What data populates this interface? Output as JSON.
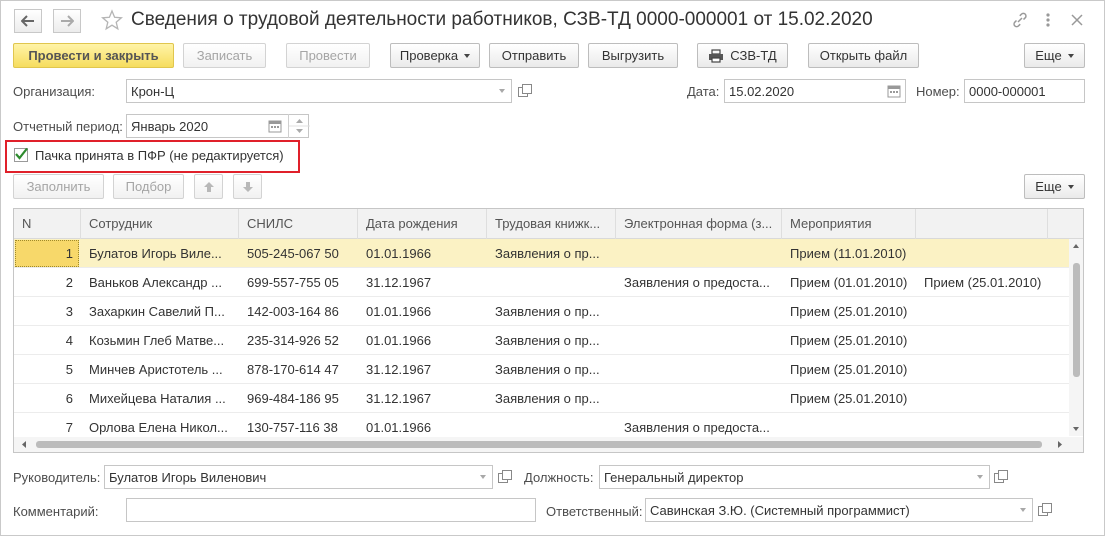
{
  "window": {
    "title": "Сведения о трудовой деятельности работников, СЗВ-ТД 0000-000001 от 15.02.2020",
    "icons": [
      "back-arrow-icon",
      "forward-arrow-icon",
      "star-icon",
      "link-icon",
      "more-vertical-icon",
      "close-icon"
    ]
  },
  "toolbar": {
    "post_close": "Провести и закрыть",
    "save": "Записать",
    "post": "Провести",
    "check": "Проверка",
    "send": "Отправить",
    "upload": "Выгрузить",
    "print_szv": "СЗВ-ТД",
    "open_file": "Открыть файл",
    "more": "Еще"
  },
  "form": {
    "org_label": "Организация:",
    "org_value": "Крон-Ц",
    "date_label": "Дата:",
    "date_value": "15.02.2020",
    "number_label": "Номер:",
    "number_value": "0000-000001",
    "period_label": "Отчетный период:",
    "period_value": "Январь 2020",
    "accepted_checked": true,
    "accepted_label": "Пачка принята в ПФР (не редактируется)"
  },
  "table_toolbar": {
    "fill": "Заполнить",
    "select": "Подбор",
    "more": "Еще"
  },
  "table": {
    "headers": [
      "N",
      "Сотрудник",
      "СНИЛС",
      "Дата рождения",
      "Трудовая книжк...",
      "Электронная форма (з...",
      "Мероприятия",
      ""
    ],
    "rows": [
      [
        "1",
        "Булатов Игорь Виле...",
        "505-245-067 50",
        "01.01.1966",
        "Заявления о пр...",
        "",
        "Прием (11.01.2010)",
        ""
      ],
      [
        "2",
        "Ваньков Александр ...",
        "699-557-755 05",
        "31.12.1967",
        "",
        "Заявления о предоста...",
        "Прием (01.01.2010)",
        "Прием (25.01.2010)"
      ],
      [
        "3",
        "Захаркин Савелий П...",
        "142-003-164 86",
        "01.01.1966",
        "Заявления о пр...",
        "",
        "Прием (25.01.2010)",
        ""
      ],
      [
        "4",
        "Козьмин Глеб Матве...",
        "235-314-926 52",
        "01.01.1966",
        "Заявления о пр...",
        "",
        "Прием (25.01.2010)",
        ""
      ],
      [
        "5",
        "Минчев Аристотель ...",
        "878-170-614 47",
        "31.12.1967",
        "Заявления о пр...",
        "",
        "Прием (25.01.2010)",
        ""
      ],
      [
        "6",
        "Михейцева Наталия ...",
        "969-484-186 95",
        "31.12.1967",
        "Заявления о пр...",
        "",
        "Прием (25.01.2010)",
        ""
      ],
      [
        "7",
        "Орлова Елена Никол...",
        "130-757-116 38",
        "01.01.1966",
        "",
        "Заявления о предоста...",
        "",
        ""
      ]
    ]
  },
  "footer": {
    "head_label": "Руководитель:",
    "head_value": "Булатов Игорь Виленович",
    "position_label": "Должность:",
    "position_value": "Генеральный директор",
    "comment_label": "Комментарий:",
    "comment_value": "",
    "responsible_label": "Ответственный:",
    "responsible_value": "Савинская З.Ю. (Системный программист)"
  },
  "colors": {
    "primary_button": "#f6dd5e",
    "selected_row": "#fbf2c4",
    "highlight_frame": "#e0202a",
    "checkmark": "#2e8b2e"
  }
}
